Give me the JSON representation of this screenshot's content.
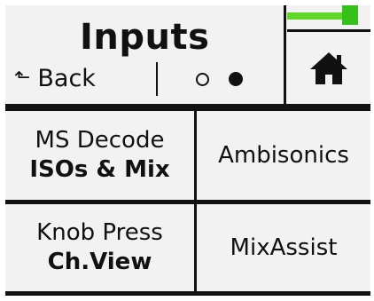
{
  "header": {
    "title": "Inputs",
    "back_icon": "⬑",
    "back_label": "Back",
    "page_count": 2,
    "current_page": 2,
    "meter_level": 0.85
  },
  "grid": {
    "ms_decode": {
      "line1": "MS Decode",
      "line2": "ISOs & Mix"
    },
    "ambisonics": {
      "label": "Ambisonics"
    },
    "knob_press": {
      "line1": "Knob Press",
      "line2": "Ch.View"
    },
    "mixassist": {
      "label": "MixAssist"
    }
  },
  "colors": {
    "background": "#f2f2f2",
    "meter_green": "#5fd82a",
    "text": "#111111"
  }
}
